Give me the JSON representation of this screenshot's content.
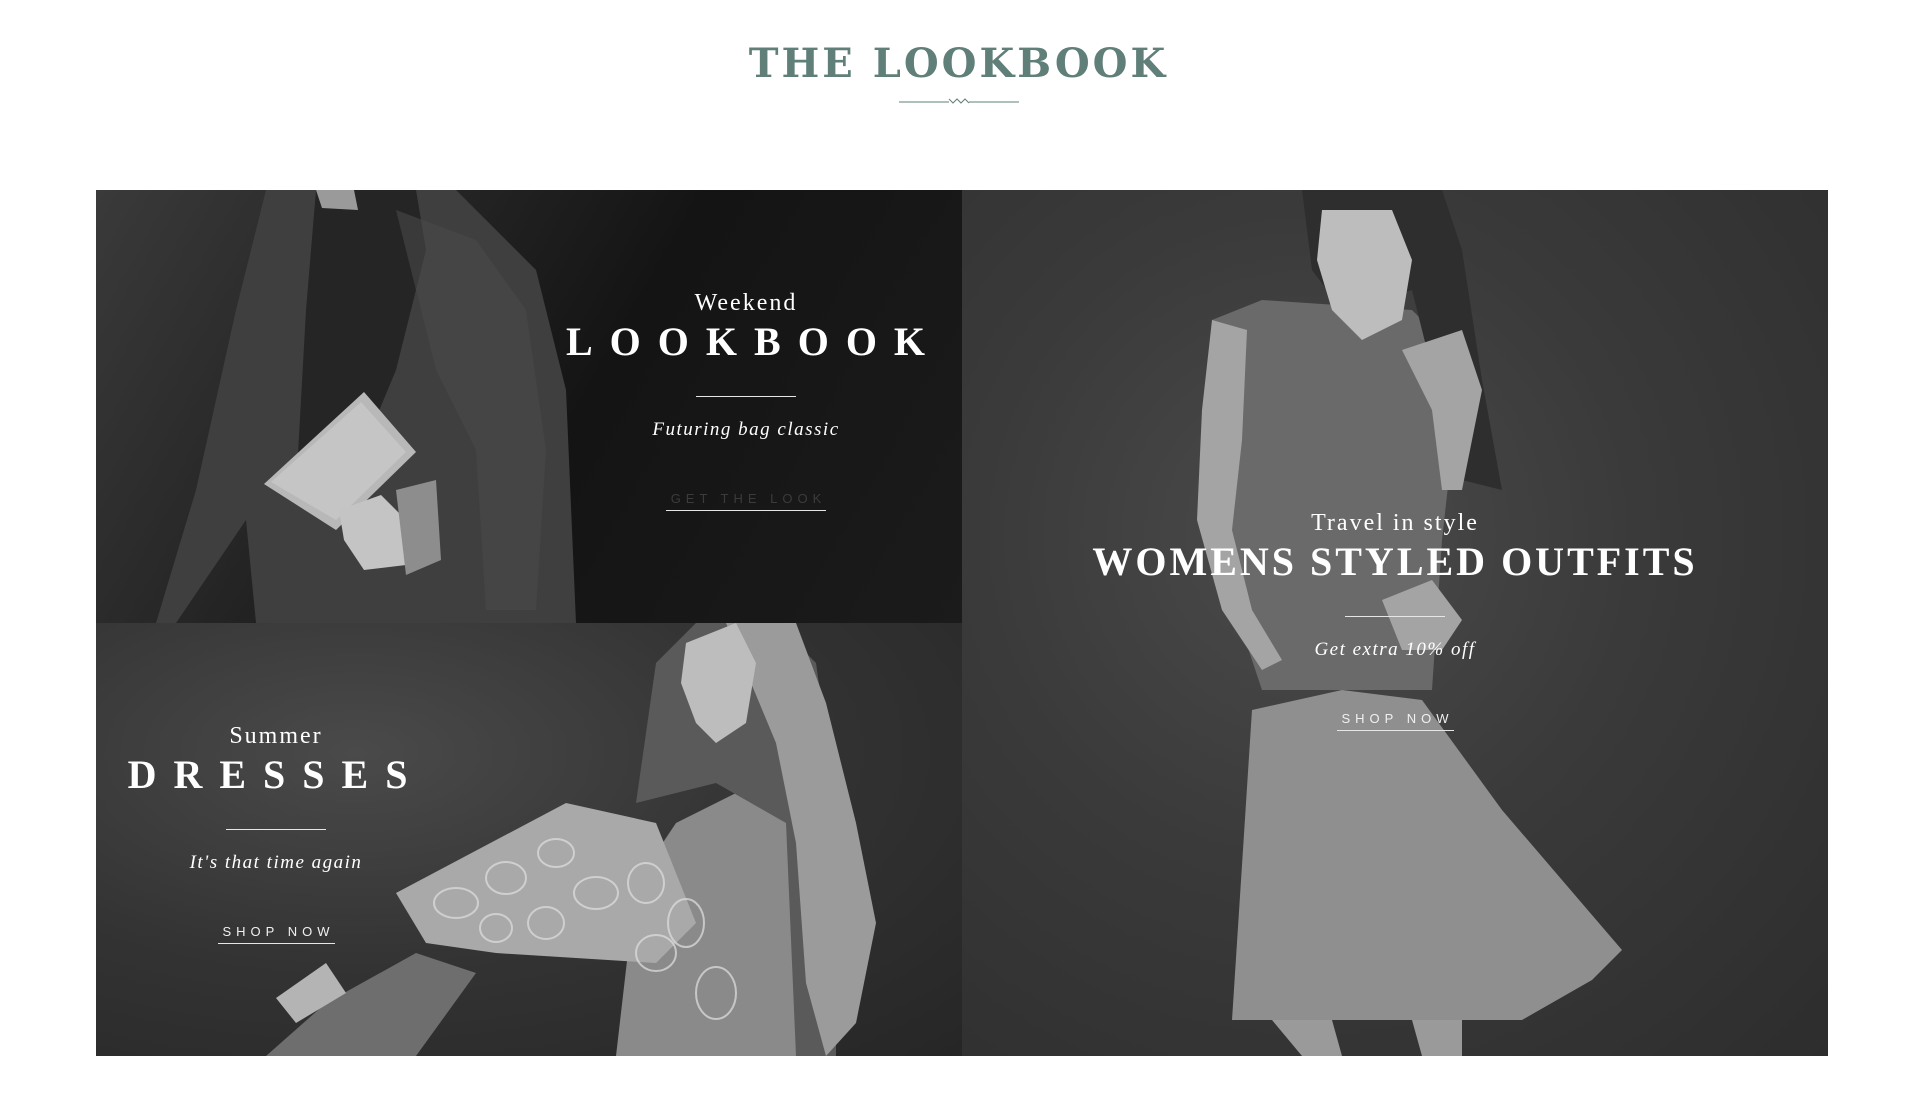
{
  "page": {
    "title": "THE LOOKBOOK"
  },
  "tiles": [
    {
      "kicker": "Weekend",
      "headline": "LOOKBOOK",
      "subtitle": "Futuring bag classic",
      "cta": "GET THE LOOK"
    },
    {
      "kicker": "Summer",
      "headline": "DRESSES",
      "subtitle": "It's that time again",
      "cta": "SHOP NOW"
    },
    {
      "kicker": "Travel in style",
      "headline": "WOMENS STYLED OUTFITS",
      "subtitle": "Get extra 10% off",
      "cta": "SHOP NOW"
    }
  ],
  "colors": {
    "title": "#5f7f78",
    "text": "#ffffff"
  }
}
